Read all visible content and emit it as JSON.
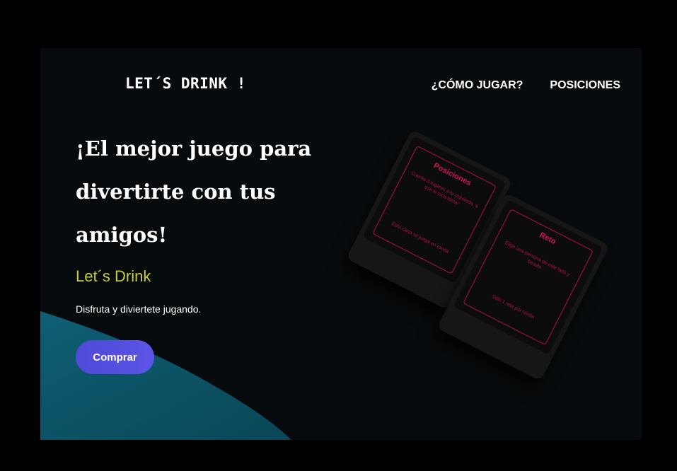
{
  "header": {
    "logo": "LET´S DRINK !",
    "nav": [
      {
        "label": "¿CÓMO JUGAR?"
      },
      {
        "label": "POSICIONES"
      }
    ]
  },
  "hero": {
    "title": "¡El mejor juego para divertirte con tus amigos!",
    "subtitle": "Let´s Drink",
    "description": "Disfruta y diviertete jugando.",
    "button_label": "Comprar"
  },
  "cards": [
    {
      "title": "Posiciones",
      "text": "Cuenta 3 lugares a tu izquierda, a ese le toca tomar",
      "footer": "Esta carta se juega en ronda"
    },
    {
      "title": "Reto",
      "text": "Elige una persona de este lado y besala",
      "footer": "Solo 1 reto por ronda"
    }
  ],
  "colors": {
    "background": "#080b0d",
    "accent_yellow": "#c8cc3a",
    "button": "#5b54e6",
    "wave": "#0e5f74",
    "card_red": "#b3123e"
  }
}
